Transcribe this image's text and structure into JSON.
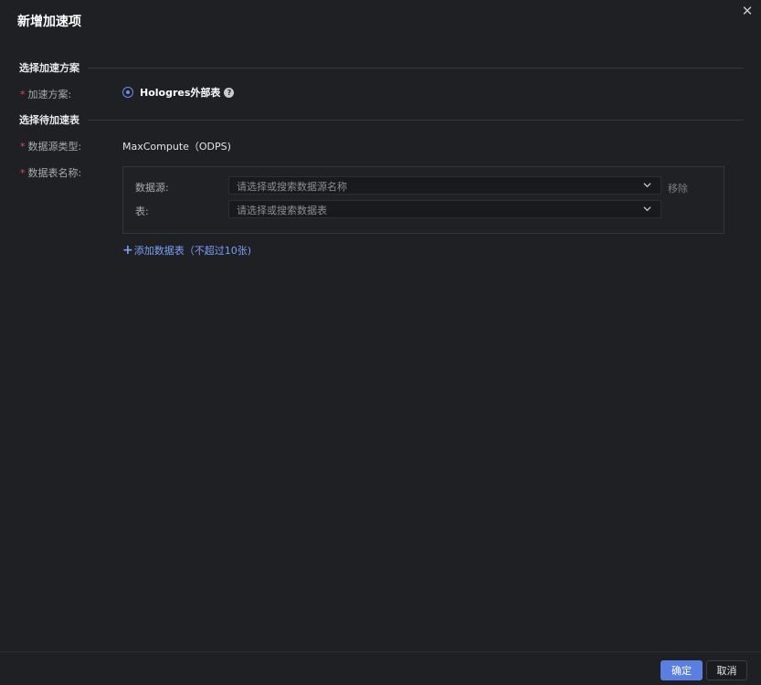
{
  "dialog": {
    "title": "新增加速项",
    "close_symbol": "✕"
  },
  "sections": {
    "scheme": "选择加速方案",
    "tables": "选择待加速表"
  },
  "fields": {
    "scheme_label": "加速方案:",
    "scheme_option": "Hologres外部表",
    "help_symbol": "?",
    "source_type_label": "数据源类型:",
    "source_type_value": "MaxCompute（ODPS)",
    "table_name_label": "数据表名称:",
    "required_mark": "*"
  },
  "table_entry": {
    "datasource_label": "数据源:",
    "datasource_placeholder": "请选择或搜索数据源名称",
    "table_label": "表:",
    "table_placeholder": "请选择或搜索数据表",
    "remove_label": "移除"
  },
  "add_table": {
    "plus": "+",
    "label": "添加数据表（不超过10张)"
  },
  "footer": {
    "confirm": "确定",
    "cancel": "取消"
  }
}
